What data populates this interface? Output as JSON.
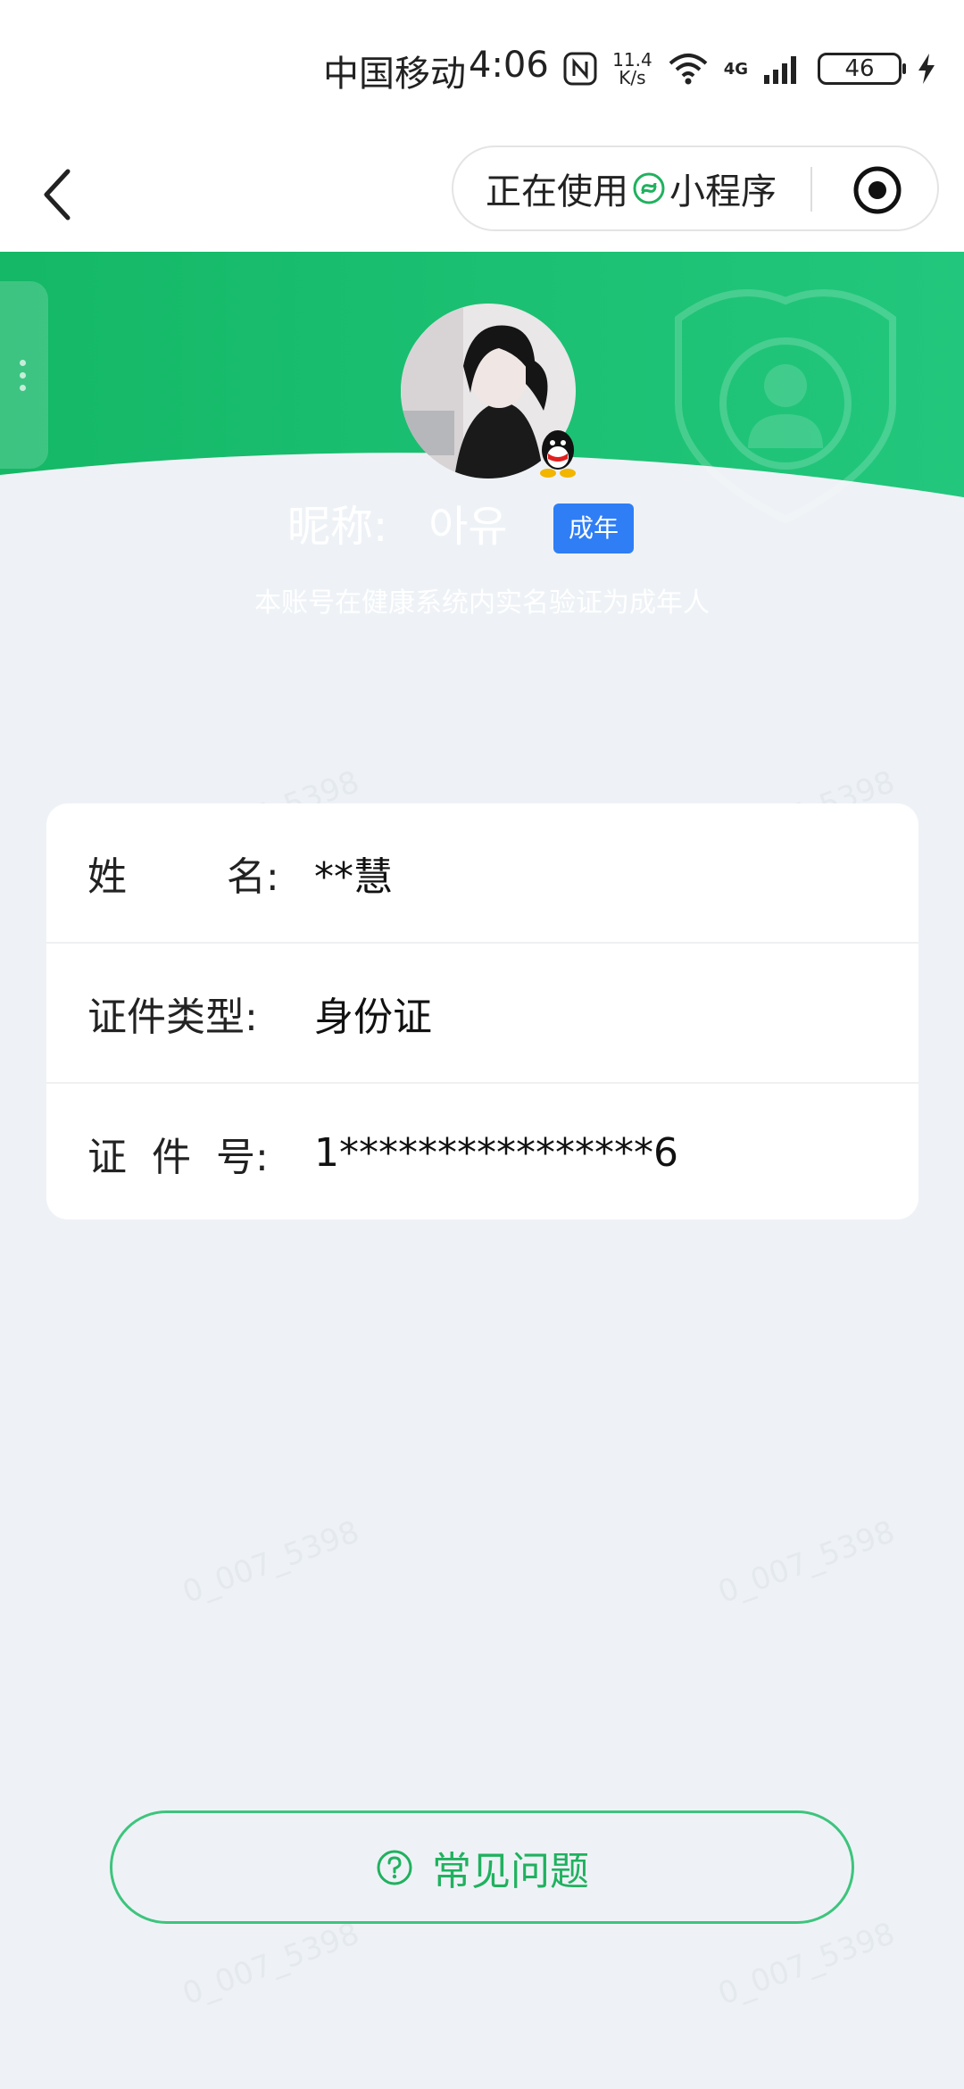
{
  "status_bar": {
    "carrier": "中国移动",
    "time": "4:06",
    "net_speed_value": "11.4",
    "net_speed_unit": "K/s",
    "network_type": "4G",
    "battery": "46"
  },
  "nav": {
    "capsule_prefix": "正在使用",
    "capsule_suffix": "小程序"
  },
  "profile": {
    "nickname_label": "昵称:",
    "nickname": "아유",
    "badge": "成年",
    "verify_text": "本账号在健康系统内实名验证为成年人"
  },
  "info_rows": [
    {
      "label": "姓        名:",
      "value": "**慧"
    },
    {
      "label": "证件类型:",
      "value": "身份证"
    },
    {
      "label": "证  件  号:",
      "value": "1****************6"
    }
  ],
  "faq": {
    "label": "常见问题"
  },
  "watermark": "0_007_5398",
  "colors": {
    "green": "#1dbf73",
    "badge_blue": "#2f7ef5",
    "faq_green": "#20b15f"
  }
}
